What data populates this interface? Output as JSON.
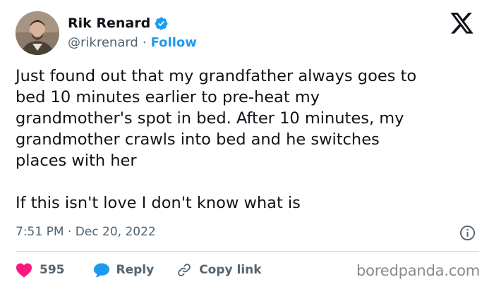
{
  "author": {
    "display_name": "Rik Renard",
    "handle": "@rikrenard",
    "separator": "·",
    "follow_label": "Follow",
    "verified": true
  },
  "icons": {
    "verified": "verified-badge-icon",
    "platform": "x-logo-icon",
    "info": "info-icon",
    "like": "heart-icon",
    "reply": "speech-bubble-icon",
    "copy": "link-icon"
  },
  "tweet": {
    "text": "Just found out that my grandfather always goes to\nbed 10 minutes earlier to pre-heat my\ngrandmother's spot in bed. After 10 minutes, my\ngrandmother crawls into bed and he switches\nplaces with her\n\nIf this isn't love I don't know what is",
    "timestamp": "7:51 PM · Dec 20, 2022"
  },
  "actions": {
    "like_count": "595",
    "reply_label": "Reply",
    "copy_label": "Copy link"
  },
  "watermark": "boredpanda.com",
  "colors": {
    "accent": "#1d9bf0",
    "like": "#f91880",
    "text": "#0f1419",
    "muted": "#536471",
    "divider": "#cfd9de"
  }
}
